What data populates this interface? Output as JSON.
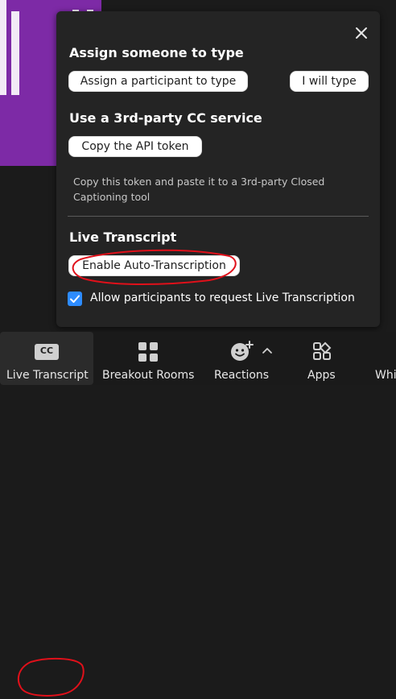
{
  "panel": {
    "assign_title": "Assign someone to type",
    "assign_participant_label": "Assign a participant to type",
    "i_will_type_label": "I will type",
    "cc_service_title": "Use a 3rd-party CC service",
    "copy_token_label": "Copy the API token",
    "copy_note": "Copy this token and paste it to a 3rd-party Closed Captioning tool",
    "live_transcript_title": "Live Transcript",
    "enable_auto_label": "Enable Auto-Transcription",
    "allow_request_label": "Allow participants to request Live Transcription",
    "allow_request_checked": true
  },
  "toolbar": {
    "cc_badge": "CC",
    "live_transcript_label": "Live Transcript",
    "breakout_rooms_label": "Breakout Rooms",
    "reactions_label": "Reactions",
    "apps_label": "Apps",
    "whiteboards_label": "Whi"
  },
  "icons": {
    "close": "close-icon",
    "cc": "cc-icon",
    "breakout": "breakout-rooms-icon",
    "reactions": "reactions-icon",
    "chevron": "chevron-up-icon",
    "apps": "apps-icon",
    "check": "check-icon"
  },
  "colors": {
    "accent_blue": "#2d8cff",
    "annotation_red": "#e0101a",
    "panel_bg": "#242424",
    "video_purple": "#7d2aa6"
  }
}
